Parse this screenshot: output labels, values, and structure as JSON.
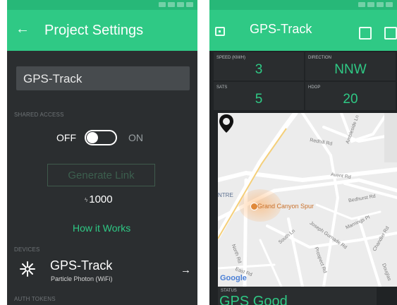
{
  "left": {
    "title": "Project Settings",
    "project_name": "GPS-Track",
    "shared_access_label": "SHARED ACCESS",
    "toggle_off": "OFF",
    "toggle_on": "ON",
    "generate_link": "Generate Link",
    "cost": "1000",
    "how_it_works": "How it Works",
    "devices_label": "DEVICES",
    "device_name": "GPS-Track",
    "device_type": "Particle Photon (WiFi)",
    "auth_tokens_label": "AUTH TOKENS"
  },
  "right": {
    "title": "GPS-Track",
    "speed": {
      "label": "SPEED (KM/H)",
      "value": "3"
    },
    "direction": {
      "label": "DIRECTION",
      "value": "NNW"
    },
    "sats": {
      "label": "SATS",
      "value": "5"
    },
    "hdop": {
      "label": "HDOP",
      "value": "20"
    },
    "map": {
      "streets": [
        "Redhill Rd",
        "Ambleside Ln",
        "Avent Rd",
        "Bedhurst Rd",
        "Marnings Pl",
        "South Ln",
        "Joseph Gurnade Rd",
        "Prospect Rd",
        "North Rd",
        "East Rd",
        "Chandler Rd",
        "Douglas"
      ],
      "area_label": "NTRE",
      "poi": "Grand Canyon Spur",
      "provider": "Google"
    },
    "status": {
      "label": "STATUS",
      "value": "GPS Good"
    }
  },
  "colors": {
    "accent": "#2fc985",
    "appbar": "#2fc985",
    "statusbar": "#27b878",
    "panel_bg": "#2b2e30"
  }
}
